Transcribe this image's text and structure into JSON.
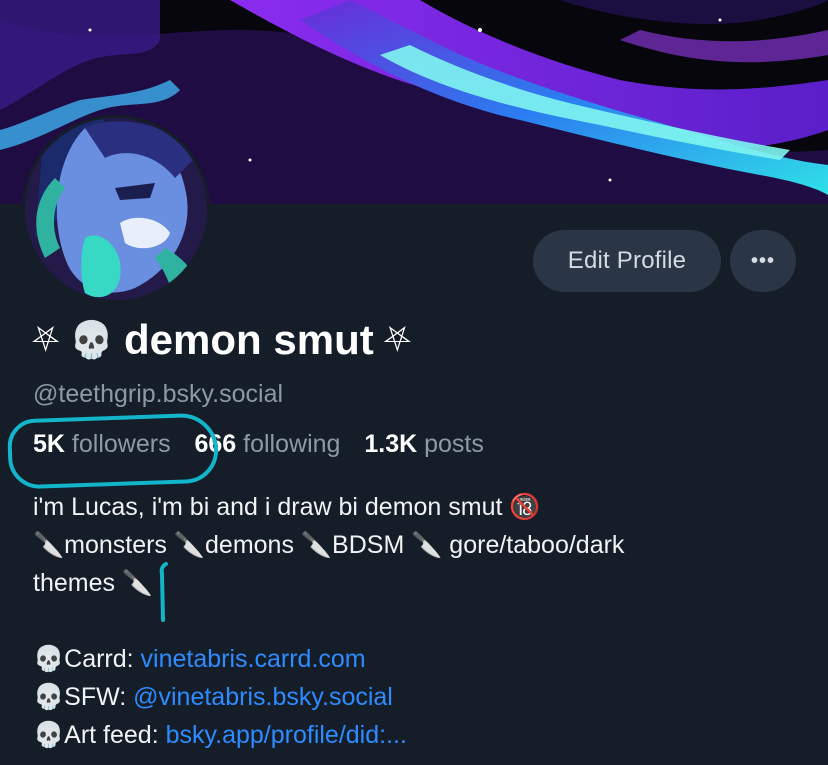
{
  "profile": {
    "display_name": "demon smut",
    "name_prefix_symbol": "⛧",
    "name_emoji": "💀",
    "name_suffix_symbol": "⛧",
    "handle": "@teethgrip.bsky.social",
    "edit_button": "Edit Profile",
    "more_button": "•••",
    "stats": {
      "followers_count": "5K",
      "followers_label": "followers",
      "following_count": "666",
      "following_label": "following",
      "posts_count": "1.3K",
      "posts_label": "posts"
    },
    "bio": {
      "line1": "i'm Lucas, i'm bi and i draw bi demon smut 🔞",
      "tags": [
        "🔪monsters",
        "🔪demons",
        "🔪BDSM",
        "🔪 gore/taboo/dark"
      ],
      "line3": "themes 🔪",
      "links": [
        {
          "emoji": "💀",
          "label": "Carrd: ",
          "url": "vinetabris.carrd.com"
        },
        {
          "emoji": "💀",
          "label": "SFW: ",
          "url": "@vinetabris.bsky.social"
        },
        {
          "emoji": "💀",
          "label": "Art feed: ",
          "url": "bsky.app/profile/did:..."
        }
      ]
    }
  },
  "annotation_color": "#12b5c9",
  "link_color": "#2d8cff"
}
